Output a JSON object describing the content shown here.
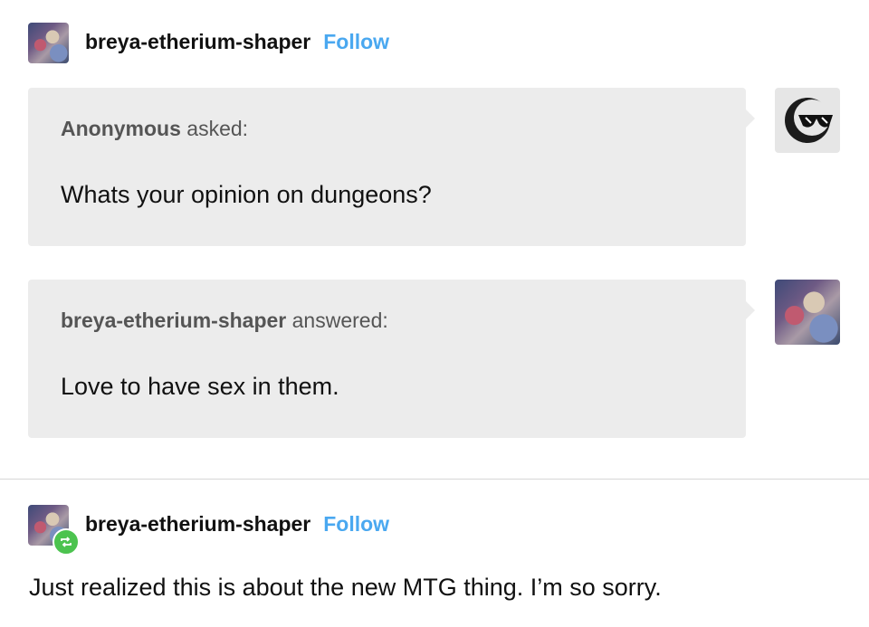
{
  "post": {
    "username": "breya-etherium-shaper",
    "follow_label": "Follow"
  },
  "ask": {
    "asker": "Anonymous",
    "asked_label": "asked:",
    "question": "Whats your opinion on dungeons?"
  },
  "answer": {
    "answerer": "breya-etherium-shaper",
    "answered_label": "answered:",
    "text": "Love to have sex in them."
  },
  "reblog": {
    "username": "breya-etherium-shaper",
    "follow_label": "Follow",
    "text": "Just realized this is about the new MTG thing. I’m so sorry."
  },
  "colors": {
    "follow": "#4aa8f0",
    "bubble": "#ececec",
    "reblog_badge": "#4cc34f"
  },
  "icons": {
    "anon_avatar": "sunglasses-face-icon",
    "reblog_badge": "reblog-icon"
  }
}
